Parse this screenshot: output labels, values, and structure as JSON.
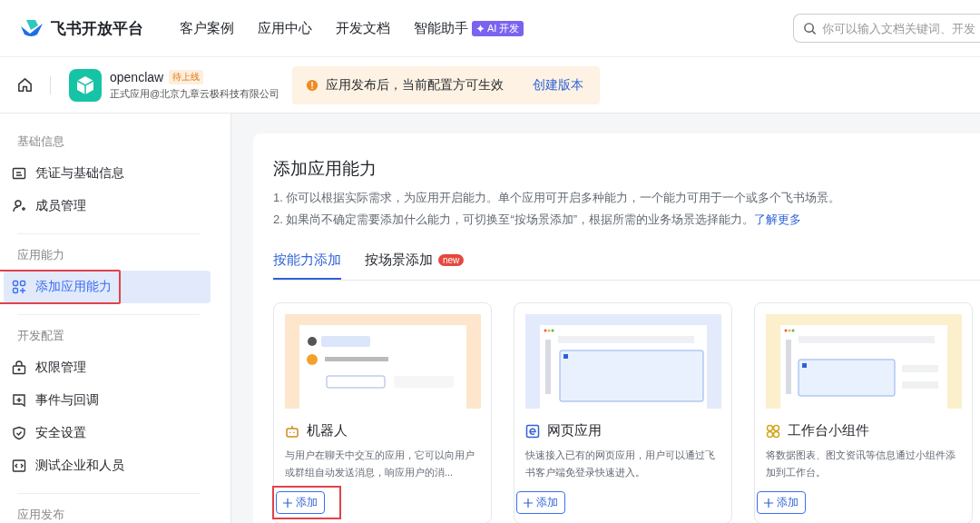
{
  "brand": "飞书开放平台",
  "nav": [
    {
      "label": "客户案例"
    },
    {
      "label": "应用中心"
    },
    {
      "label": "开发文档"
    },
    {
      "label": "智能助手",
      "badge": "AI 开发"
    }
  ],
  "search": {
    "placeholder": "你可以输入文档关键词、开发"
  },
  "app": {
    "name": "openclaw",
    "status": "待上线",
    "subtitle": "正式应用@北京九章云极科技有限公司"
  },
  "notice": {
    "text": "应用发布后，当前配置方可生效",
    "link": "创建版本"
  },
  "sidebar": [
    {
      "title": "基础信息",
      "items": [
        {
          "label": "凭证与基础信息",
          "selected": false,
          "highlighted": false
        },
        {
          "label": "成员管理",
          "selected": false,
          "highlighted": false
        }
      ]
    },
    {
      "title": "应用能力",
      "items": [
        {
          "label": "添加应用能力",
          "selected": true,
          "highlighted": true
        }
      ]
    },
    {
      "title": "开发配置",
      "items": [
        {
          "label": "权限管理",
          "selected": false,
          "highlighted": false
        },
        {
          "label": "事件与回调",
          "selected": false,
          "highlighted": false
        },
        {
          "label": "安全设置",
          "selected": false,
          "highlighted": false
        },
        {
          "label": "测试企业和人员",
          "selected": false,
          "highlighted": false
        }
      ]
    },
    {
      "title": "应用发布"
    }
  ],
  "main": {
    "title": "添加应用能力",
    "lines": [
      "1. 你可以根据实际需求，为应用开启能力。单个应用可开启多种能力，一个能力可用于一个或多个飞书场景。",
      "2. 如果尚不确定需要添加什么能力，可切换至“按场景添加”，根据所需的业务场景选择能力。"
    ],
    "link": "了解更多",
    "tabs": [
      {
        "label": "按能力添加",
        "selected": true
      },
      {
        "label": "按场景添加",
        "selected": false,
        "badge": "new"
      }
    ],
    "cards": [
      {
        "title": "机器人",
        "description": "与用户在聊天中交互的应用，它可以向用户或群组自动发送消息，响应用户的消...",
        "button": "添加",
        "color": "#fde6cc",
        "highlighted": true
      },
      {
        "title": "网页应用",
        "description": "快速接入已有的网页应用，用户可以通过飞书客户端免登录快速进入。",
        "button": "添加",
        "color": "#e3eafb",
        "highlighted": false
      },
      {
        "title": "工作台小组件",
        "description": "将数据图表、图文资讯等信息通过小组件添加到工作台。",
        "button": "添加",
        "color": "#fcefcc",
        "highlighted": false
      }
    ]
  }
}
